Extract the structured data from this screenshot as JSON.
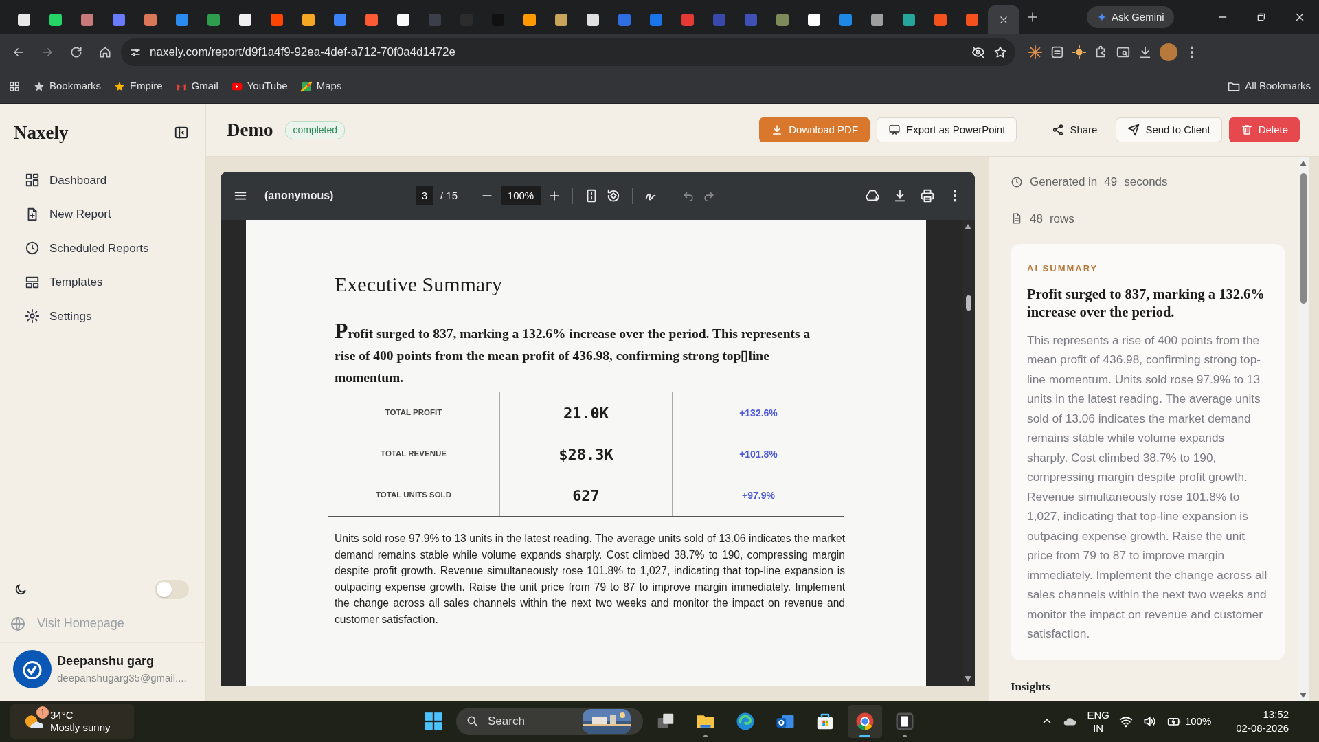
{
  "browser": {
    "tabs": [
      {
        "color": "#e8e8e8",
        "selected": false
      },
      {
        "color": "#25d366",
        "selected": false
      },
      {
        "color": "#c87a7a",
        "selected": false
      },
      {
        "color": "#6b7bff",
        "selected": false
      },
      {
        "color": "#d97757",
        "selected": false
      },
      {
        "color": "#2a8cf0",
        "selected": false
      },
      {
        "color": "#2e9e4e",
        "selected": false
      },
      {
        "color": "#f0f0f0",
        "selected": false
      },
      {
        "color": "#ff4500",
        "selected": false
      },
      {
        "color": "#f5a623",
        "selected": false
      },
      {
        "color": "#3b82f6",
        "selected": false
      },
      {
        "color": "#ff5a36",
        "selected": false
      },
      {
        "color": "#fafafa",
        "selected": false
      },
      {
        "color": "#3a3f4a",
        "selected": false
      },
      {
        "color": "#2c2c2c",
        "selected": false
      },
      {
        "color": "#111111",
        "selected": false
      },
      {
        "color": "#ff9900",
        "selected": false
      },
      {
        "color": "#c9a45b",
        "selected": false
      },
      {
        "color": "#e0e0e0",
        "selected": false
      },
      {
        "color": "#2f6ee0",
        "selected": false
      },
      {
        "color": "#1a73e8",
        "selected": false
      },
      {
        "color": "#e53935",
        "selected": false
      },
      {
        "color": "#3949ab",
        "selected": false
      },
      {
        "color": "#3f51b5",
        "selected": false
      },
      {
        "color": "#7d8b5a",
        "selected": false
      },
      {
        "color": "#ffffff",
        "selected": false
      },
      {
        "color": "#1e88e5",
        "selected": false
      },
      {
        "color": "#9e9e9e",
        "selected": false
      },
      {
        "color": "#26a69a",
        "selected": false
      },
      {
        "color": "#f4511e",
        "selected": false
      },
      {
        "color": "#f4511e",
        "selected": false
      },
      {
        "selected": true
      }
    ],
    "gemini": "Ask Gemini",
    "url": "naxely.com/report/d9f1a4f9-92ea-4def-a712-70f0a4d1472e",
    "bookmarks": [
      "Bookmarks",
      "Empire",
      "Gmail",
      "YouTube",
      "Maps"
    ],
    "all_bookmarks": "All Bookmarks"
  },
  "app": {
    "brand": "Naxely",
    "nav": [
      {
        "label": "Dashboard",
        "selected": false
      },
      {
        "label": "New Report",
        "selected": false
      },
      {
        "label": "Scheduled Reports",
        "selected": false
      },
      {
        "label": "Templates",
        "selected": false
      },
      {
        "label": "Settings",
        "selected": false
      }
    ],
    "dark_mode": {
      "on": false
    },
    "visit_homepage": "Visit Homepage",
    "user": {
      "name": "Deepanshu garg",
      "email": "deepanshugarg35@gmail...."
    }
  },
  "report": {
    "title": "Demo",
    "status": "completed",
    "actions": [
      {
        "label": "Download PDF",
        "kind": "primary"
      },
      {
        "label": "Export as PowerPoint",
        "kind": "outline"
      },
      {
        "label": "Share",
        "kind": "plain"
      },
      {
        "label": "Send to Client",
        "kind": "outline"
      },
      {
        "label": "Delete",
        "kind": "danger"
      }
    ]
  },
  "viewer": {
    "filename": "(anonymous)",
    "page": "3",
    "page_count": "/ 15",
    "zoom": "100%"
  },
  "page": {
    "heading": "Executive Summary",
    "lead": "Profit surged to 837, marking a 132.6% increase over the period. This represents a rise of 400 points from the mean profit of 436.98, confirming strong top▯line momentum.",
    "metrics": [
      {
        "label": "TOTAL PROFIT",
        "value": "21.0K",
        "change": "+132.6%"
      },
      {
        "label": "TOTAL REVENUE",
        "value": "$28.3K",
        "change": "+101.8%"
      },
      {
        "label": "TOTAL UNITS SOLD",
        "value": "627",
        "change": "+97.9%"
      }
    ],
    "body": "Units sold rose 97.9% to 13 units in the latest reading. The average units sold of 13.06 indicates the market demand remains stable while volume expands sharply. Cost climbed 38.7% to 190, compressing margin despite profit growth. Revenue simultaneously rose 101.8% to 1,027, indicating that top-line expansion is outpacing expense growth. Raise the unit price from 79 to 87 to improve margin immediately. Implement the change across all sales channels within the next two weeks and monitor the impact on revenue and customer satisfaction."
  },
  "details": {
    "generated_label": "Generated in",
    "generated_value": "49",
    "generated_unit": "seconds",
    "rows_value": "48",
    "rows_unit": "rows",
    "summary": {
      "label": "AI SUMMARY",
      "headline": "Profit surged to 837, marking a 132.6% increase over the period.",
      "text": "This represents a rise of 400 points from the mean profit of 436.98, confirming strong top-line momentum. Units sold rose 97.9% to 13 units in the latest reading. The average units sold of 13.06 indicates the market demand remains stable while volume expands sharply. Cost climbed 38.7% to 190, compressing margin despite profit growth. Revenue simultaneously rose 101.8% to 1,027, indicating that top-line expansion is outpacing expense growth. Raise the unit price from 79 to 87 to improve margin immediately. Implement the change across all sales channels within the next two weeks and monitor the impact on revenue and customer satisfaction."
    },
    "next_section": "Insights"
  },
  "taskbar": {
    "weather": {
      "temp": "34°C",
      "condition": "Mostly sunny",
      "badge": "1"
    },
    "search": {
      "placeholder": "Search"
    },
    "apps": [
      {
        "running": false,
        "selected": false
      },
      {
        "running": true,
        "selected": false
      },
      {
        "running": false,
        "selected": false
      },
      {
        "running": false,
        "selected": false
      },
      {
        "running": false,
        "selected": false
      },
      {
        "running": true,
        "selected": true
      },
      {
        "running": true,
        "selected": false
      }
    ],
    "language": "ENG",
    "region": "IN",
    "battery": "100%",
    "time": "13:52",
    "date": "02-08-2026"
  }
}
